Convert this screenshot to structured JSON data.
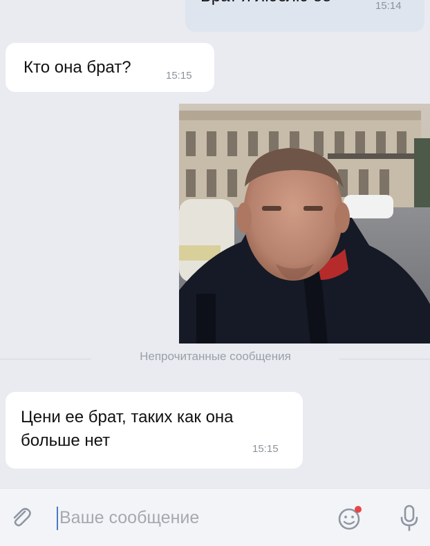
{
  "messages": [
    {
      "text": "Брат я люблю ее",
      "time": "15:14",
      "direction": "outgoing"
    },
    {
      "text": "Кто она брат?",
      "time": "15:15",
      "direction": "incoming"
    },
    {
      "type": "photo",
      "direction": "outgoing"
    },
    {
      "text": "Цени ее брат, таких как она больше нет",
      "time": "15:15",
      "direction": "incoming"
    }
  ],
  "divider": {
    "label": "Непрочитанные сообщения"
  },
  "composer": {
    "placeholder": "Ваше сообщение"
  },
  "icons": {
    "attach": "paperclip-icon",
    "emoji": "emoji-icon",
    "mic": "microphone-icon"
  },
  "colors": {
    "background": "#e9ebf0",
    "outgoing_bubble": "#dfe5ef",
    "incoming_bubble": "#ffffff",
    "accent": "#4a79c6",
    "notification": "#e64646"
  }
}
